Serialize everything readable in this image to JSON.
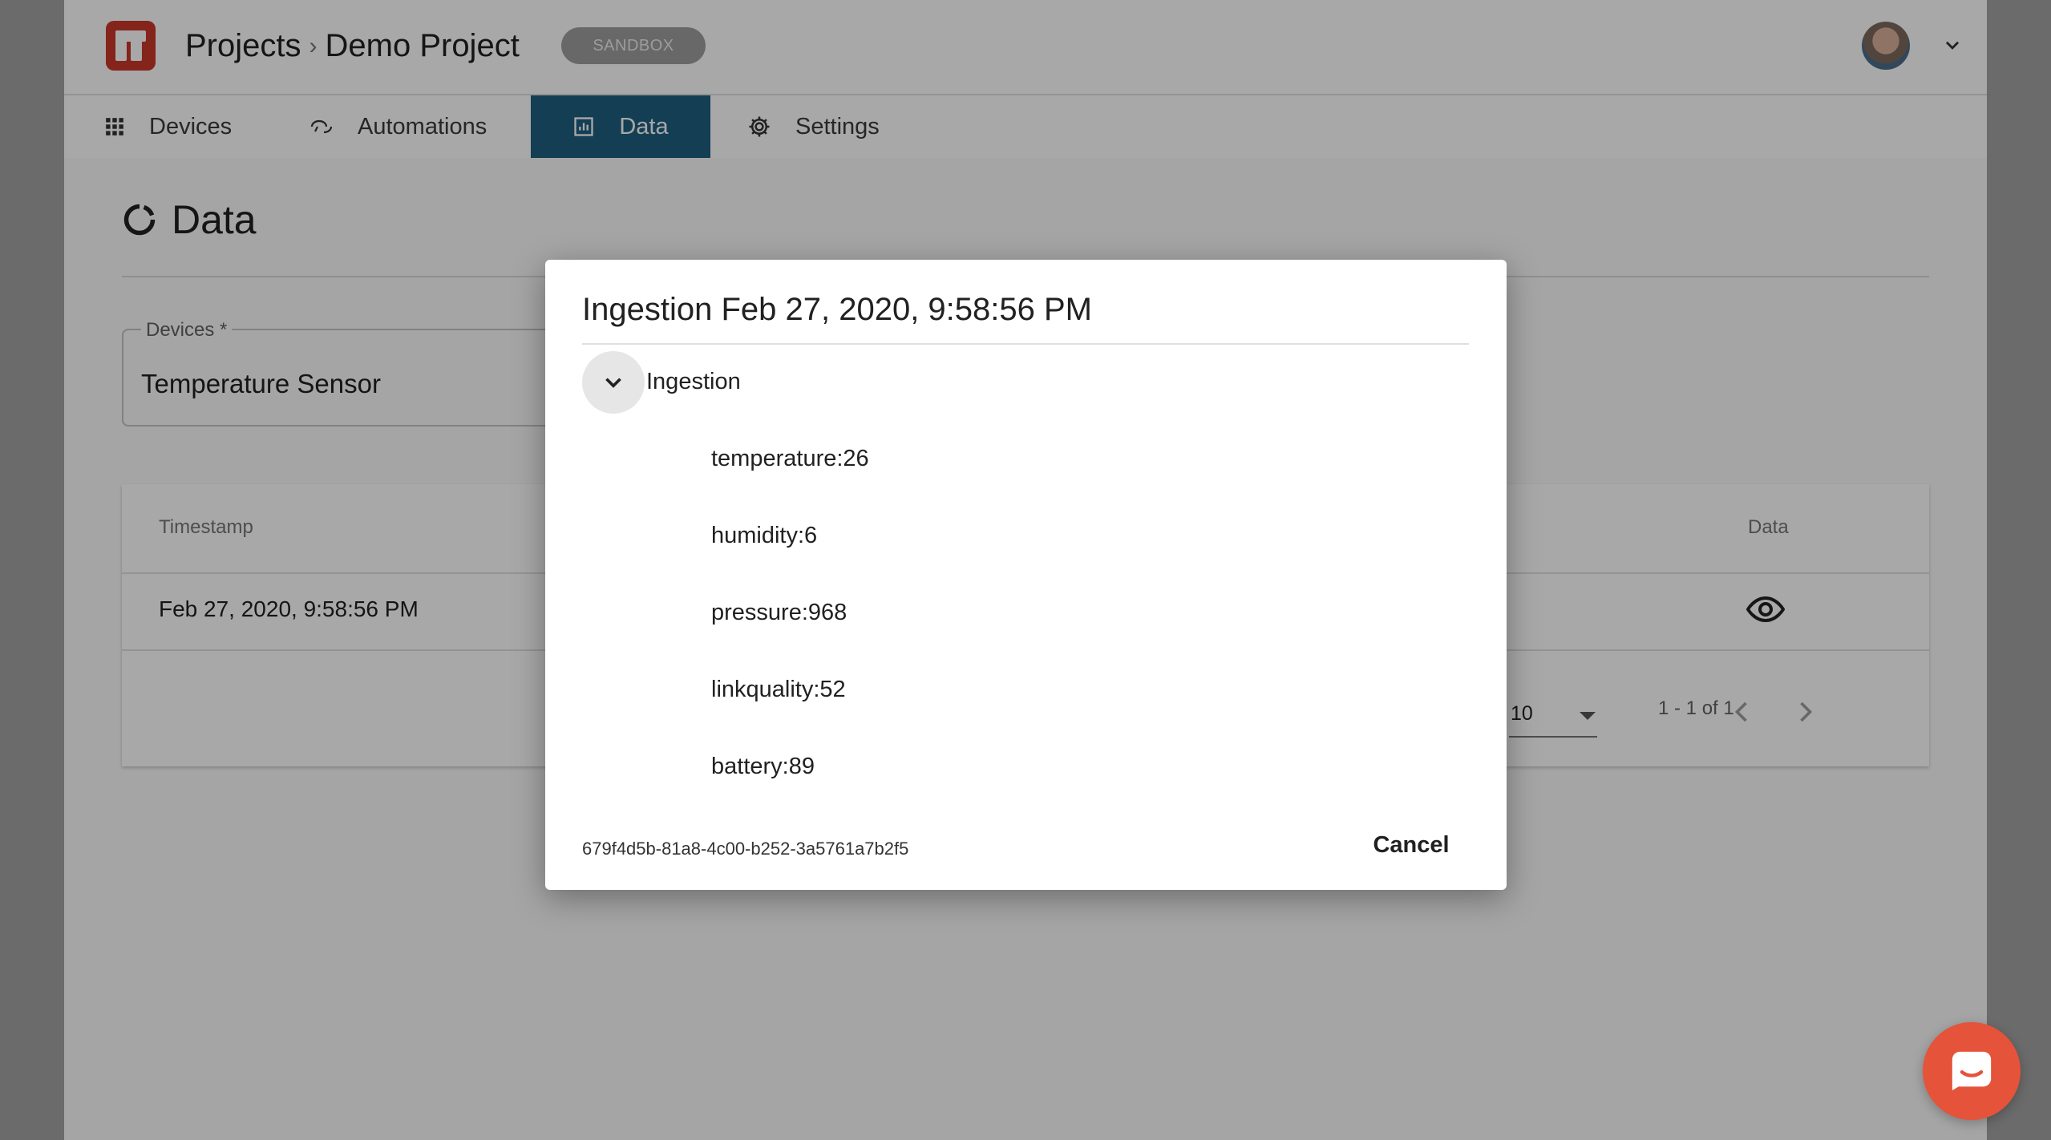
{
  "header": {
    "breadcrumb_root": "Projects",
    "breadcrumb_separator": "›",
    "project_name": "Demo Project",
    "env_badge": "SANDBOX"
  },
  "tabs": [
    {
      "label": "Devices",
      "icon": "grid-icon"
    },
    {
      "label": "Automations",
      "icon": "automation-icon"
    },
    {
      "label": "Data",
      "icon": "chart-icon",
      "active": true
    },
    {
      "label": "Settings",
      "icon": "gear-icon"
    }
  ],
  "page": {
    "title": "Data",
    "devices_label": "Devices *",
    "devices_value": "Temperature Sensor"
  },
  "table": {
    "columns": [
      "Timestamp",
      "Data"
    ],
    "rows": [
      {
        "timestamp": "Feb 27, 2020, 9:58:56 PM"
      }
    ],
    "rows_per_page": "10",
    "range": "1 - 1 of 1"
  },
  "dialog": {
    "title": "Ingestion Feb 27, 2020, 9:58:56 PM",
    "group_label": "Ingestion",
    "items": [
      "temperature:26",
      "humidity:6",
      "pressure:968",
      "linkquality:52",
      "battery:89"
    ],
    "id": "679f4d5b-81a8-4c00-b252-3a5761a7b2f5",
    "cancel_label": "Cancel"
  },
  "colors": {
    "brand": "#c8372a",
    "active_tab": "#1d5f80",
    "chat_button": "#e5533a"
  }
}
